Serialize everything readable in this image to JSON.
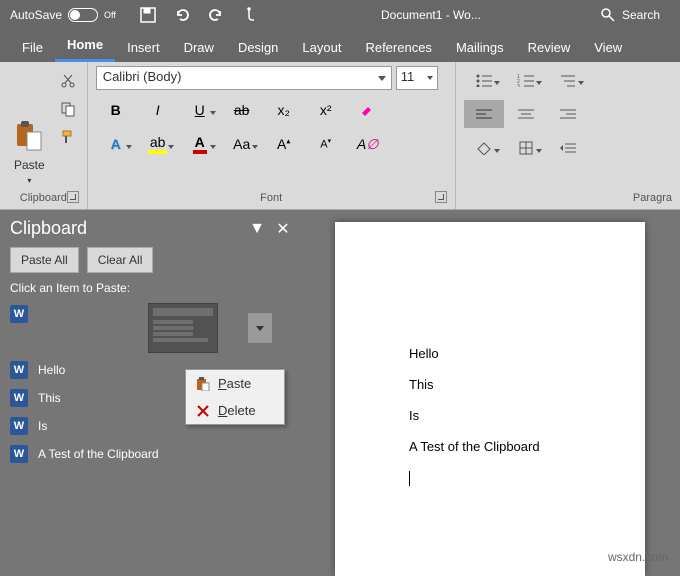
{
  "titlebar": {
    "autosave_label": "AutoSave",
    "autosave_state": "Off",
    "doc_title": "Document1 - Wo...",
    "search_placeholder": "Search"
  },
  "tabs": [
    "File",
    "Home",
    "Insert",
    "Draw",
    "Design",
    "Layout",
    "References",
    "Mailings",
    "Review",
    "View"
  ],
  "active_tab": "Home",
  "ribbon": {
    "clipboard": {
      "label": "Clipboard",
      "paste_label": "Paste"
    },
    "font": {
      "label": "Font",
      "name": "Calibri (Body)",
      "size": "11",
      "buttons": {
        "bold": "B",
        "italic": "I",
        "underline": "U",
        "strike": "ab",
        "subscript": "x₂",
        "superscript": "x²",
        "case": "Aa",
        "clear": "A"
      }
    },
    "paragraph": {
      "label": "Paragra"
    }
  },
  "clipboard_pane": {
    "title": "Clipboard",
    "paste_all": "Paste All",
    "clear_all": "Clear All",
    "hint": "Click an Item to Paste:",
    "items": [
      "Hello",
      "This",
      "Is",
      "A Test of the Clipboard"
    ],
    "context": {
      "paste": "Paste",
      "delete": "Delete"
    }
  },
  "document": {
    "lines": [
      "Hello",
      "This",
      "Is",
      "A Test of the Clipboard"
    ]
  },
  "watermark": "wsxdn.com"
}
